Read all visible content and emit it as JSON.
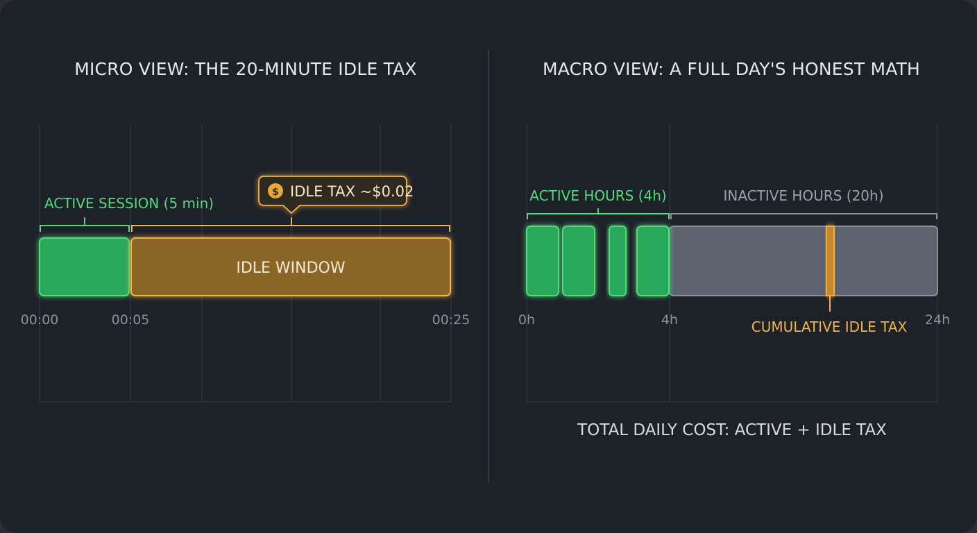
{
  "micro": {
    "title": "MICRO VIEW: THE 20-MINUTE IDLE TAX",
    "active_label": "ACTIVE SESSION (5 min)",
    "idle_label": "IDLE WINDOW",
    "tooltip": "IDLE TAX ~$0.02",
    "tooltip_icon": "dollar-coin-icon",
    "ticks": [
      "00:00",
      "00:05",
      "00:25"
    ]
  },
  "macro": {
    "title": "MACRO VIEW: A FULL DAY'S HONEST MATH",
    "active_label": "ACTIVE HOURS (4h)",
    "inactive_label": "INACTIVE HOURS (20h)",
    "marker_label": "CUMULATIVE IDLE TAX",
    "ticks": [
      "0h",
      "4h",
      "24h"
    ],
    "footer": "TOTAL DAILY COST: ACTIVE + IDLE TAX"
  },
  "colors": {
    "background": "#1d2128",
    "active": "#2aa85a",
    "active_border": "#54d97c",
    "idle": "#8a6628",
    "idle_border": "#f3b34a",
    "inactive": "#5d636e"
  }
}
